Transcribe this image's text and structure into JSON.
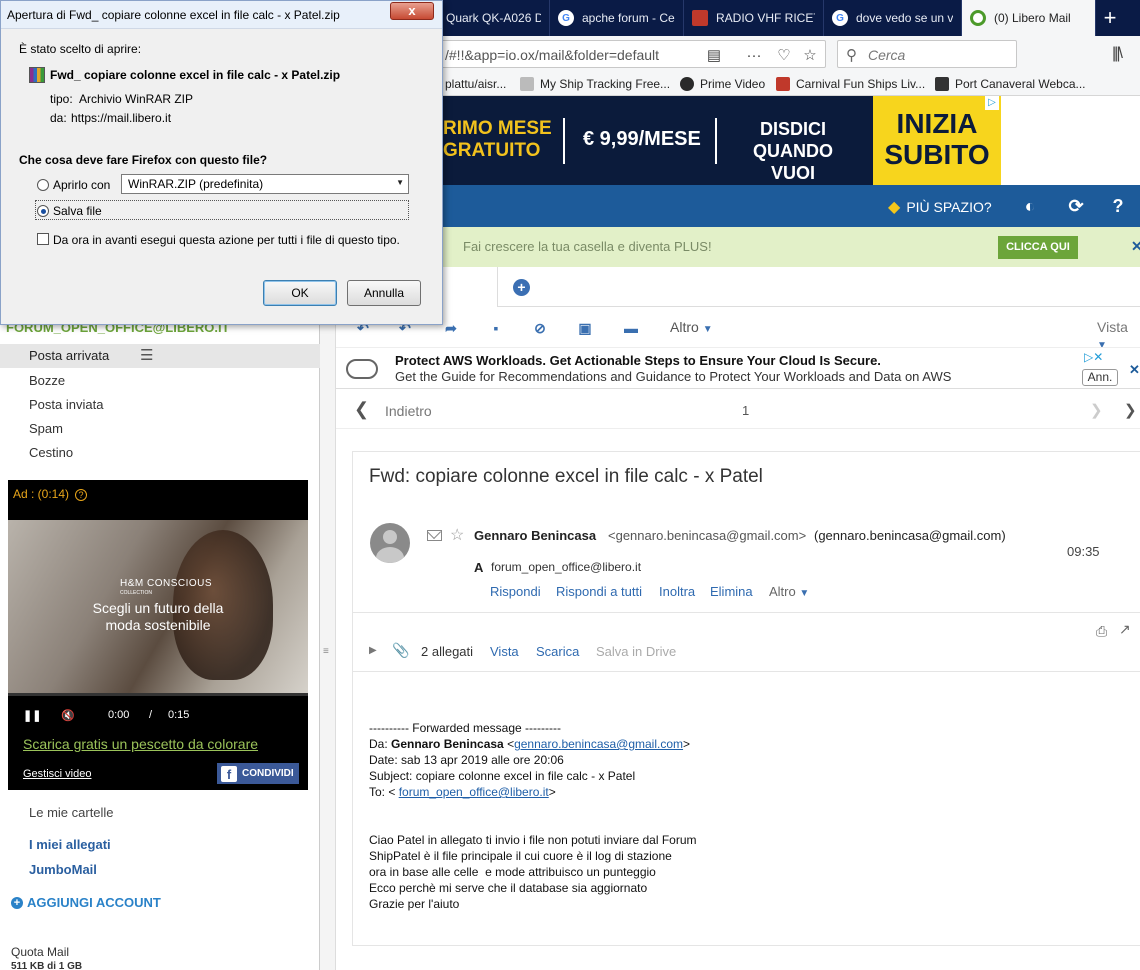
{
  "browser": {
    "tabs": [
      {
        "label": "Quark QK-A026 D",
        "icon": "page-icon"
      },
      {
        "label": "apche forum - Ce",
        "icon": "google-icon"
      },
      {
        "label": "RADIO VHF RICET",
        "icon": "radio-icon"
      },
      {
        "label": "dove vedo se un v",
        "icon": "google-icon"
      },
      {
        "label": "(0) Libero Mail",
        "icon": "libero-icon",
        "active": true
      }
    ],
    "url": "/#!!&app=io.ox/mail&folder=default",
    "search_placeholder": "Cerca",
    "bookmarks": [
      {
        "label": "plattu/aisr..."
      },
      {
        "label": "My Ship Tracking Free..."
      },
      {
        "label": "Prime Video"
      },
      {
        "label": "Carnival Fun Ships Liv..."
      },
      {
        "label": "Port Canaveral Webca..."
      }
    ]
  },
  "banner_ad": {
    "line1a": "RIMO MESE",
    "line1b": "GRATUITO",
    "price": "€ 9,99/MESE",
    "cancel_a": "DISDICI",
    "cancel_b": "QUANDO VUOI",
    "cta_a": "INIZIA",
    "cta_b": "SUBITO"
  },
  "mail_header": {
    "piu_spazio": "PIÙ SPAZIO?",
    "promo_text": "Fai crescere la tua casella e diventa PLUS!",
    "promo_button": "CLICCA QUI"
  },
  "sidebar": {
    "account": "FORUM_OPEN_OFFICE@LIBERO.IT",
    "folders": [
      "Posta arrivata",
      "Bozze",
      "Posta inviata",
      "Spam",
      "Cestino"
    ],
    "video_ad": {
      "timer": "Ad : (0:14)",
      "brand": "H&M CONSCIOUS",
      "brand_sub": "COLLECTION",
      "claim": "Scegli un futuro della moda sostenibile",
      "time_current": "0:00",
      "time_sep": "/",
      "time_total": "0:15",
      "link": "Scarica gratis un pescetto da colorare",
      "manage": "Gestisci video",
      "share": "CONDIVIDI"
    },
    "my_folders": "Le mie cartelle",
    "my_attachments": "I miei allegati",
    "jumbomail": "JumboMail",
    "add_account": "AGGIUNGI ACCOUNT",
    "quota_label": "Quota Mail",
    "quota_value": "511 KB di 1 GB"
  },
  "toolbar": {
    "altro": "Altro",
    "vista": "Vista"
  },
  "aws_ad": {
    "title": "Protect AWS Workloads. Get Actionable Steps to Ensure Your Cloud Is Secure.",
    "subtitle": "Get the Guide for Recommendations and Guidance to Protect Your Workloads and Data on AWS",
    "button": "Ann."
  },
  "navigation": {
    "back": "Indietro",
    "count": "1"
  },
  "message": {
    "subject": "Fwd: copiare colonne excel in file calc - x Patel",
    "sender_name": "Gennaro Benincasa",
    "sender_email": "<gennaro.benincasa@gmail.com>",
    "sender_email_plain": "(gennaro.benincasa@gmail.com)",
    "time": "09:35",
    "to_label": "A",
    "to": "forum_open_office@libero.it",
    "actions": [
      "Rispondi",
      "Rispondi a tutti",
      "Inoltra",
      "Elimina"
    ],
    "altro": "Altro",
    "attachments": {
      "count": "2 allegati",
      "view": "Vista",
      "download": "Scarica",
      "drive": "Salva in Drive"
    },
    "body": {
      "forward_header": "---------- Forwarded message ---------",
      "from_prefix": "Da: ",
      "from_name": "Gennaro Benincasa",
      "from_open": " <",
      "from_email": "gennaro.benincasa@gmail.com",
      "from_close": ">",
      "date": "Date: sab 13 apr 2019 alle ore 20:06",
      "subject": "Subject: copiare colonne excel in file calc - x Patel",
      "to_prefix": "To: < ",
      "to_email": "forum_open_office@libero.it",
      "to_close": ">",
      "lines": [
        "Ciao Patel in allegato ti invio i file non potuti inviare dal Forum",
        "ShipPatel è il file principale il cui cuore è il log di stazione",
        "ora in base alle celle  e mode attribuisco un punteggio",
        "Ecco perchè mi serve che il database sia aggiornato",
        "Grazie per l'aiuto"
      ]
    }
  },
  "dialog": {
    "title": "Apertura di Fwd_ copiare colonne excel in file calc - x Patel.zip",
    "close": "x",
    "intro": "È stato scelto di aprire:",
    "filename": "Fwd_ copiare colonne excel in file calc - x Patel.zip",
    "type_label": "tipo:",
    "type_value": "Archivio WinRAR ZIP",
    "from_label": "da:",
    "from_value": "https://mail.libero.it",
    "question": "Che cosa deve fare Firefox con questo file?",
    "open_with": "Aprirlo con",
    "app": "WinRAR.ZIP (predefinita)",
    "save": "Salva file",
    "remember": "Da ora in avanti esegui questa azione per tutti i file di questo tipo.",
    "ok": "OK",
    "cancel": "Annulla",
    "selected_option": "Salva file"
  }
}
